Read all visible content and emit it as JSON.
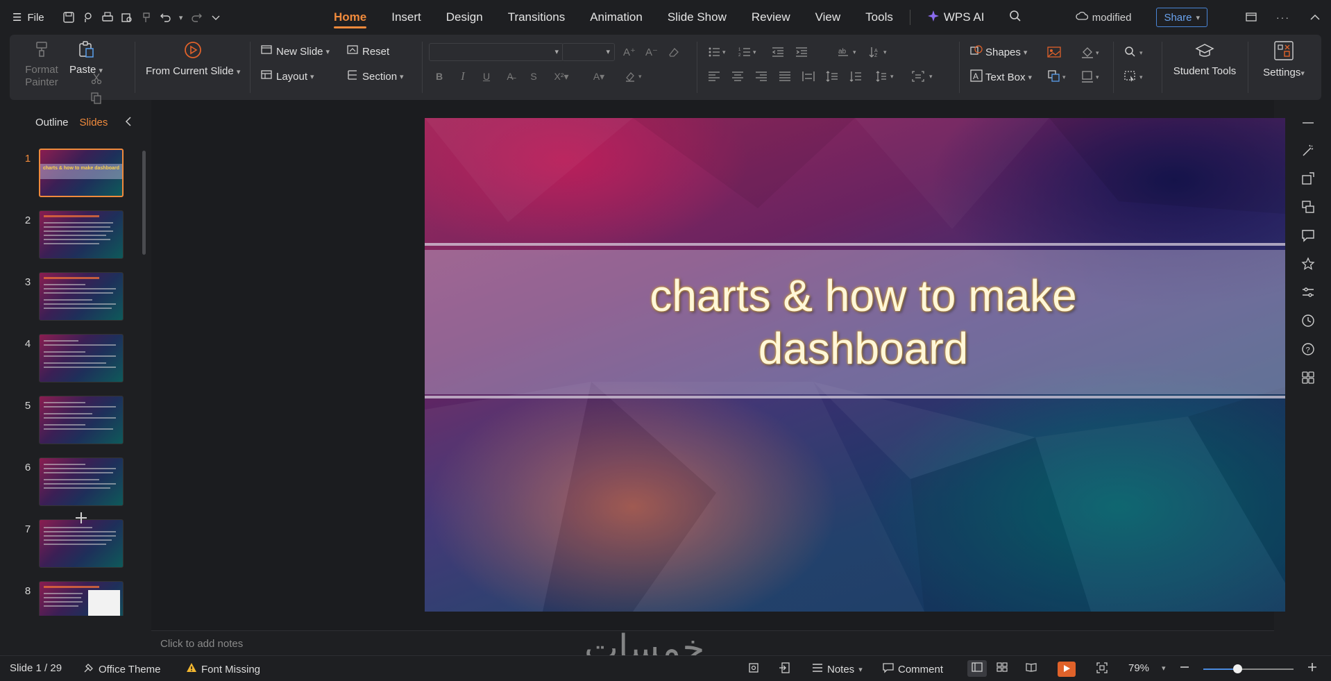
{
  "app": {
    "file_label": "File",
    "menu": [
      "Home",
      "Insert",
      "Design",
      "Transitions",
      "Animation",
      "Slide Show",
      "Review",
      "View",
      "Tools"
    ],
    "wps_ai_label": "WPS AI",
    "status_label": "modified",
    "share_label": "Share"
  },
  "ribbon": {
    "format_painter": "Format\nPainter",
    "paste": "Paste",
    "from_current_slide": "From Current Slide",
    "new_slide": "New  Slide",
    "reset": "Reset",
    "layout": "Layout",
    "section": "Section",
    "shapes": "Shapes",
    "text_box": "Text Box",
    "student_tools": "Student Tools",
    "settings": "Settings"
  },
  "panel": {
    "tab_outline": "Outline",
    "tab_slides": "Slides",
    "slides": [
      {
        "num": "1",
        "title": "charts & how to make dashboard"
      },
      {
        "num": "2"
      },
      {
        "num": "3"
      },
      {
        "num": "4"
      },
      {
        "num": "5"
      },
      {
        "num": "6"
      },
      {
        "num": "7"
      },
      {
        "num": "8"
      }
    ]
  },
  "slide": {
    "title_line1": "charts & how to make",
    "title_line2": "dashboard"
  },
  "notes_placeholder": "Click to add notes",
  "statusbar": {
    "slide_counter": "Slide 1 / 29",
    "theme": "Office Theme",
    "font_missing": "Font Missing",
    "notes": "Notes",
    "comment": "Comment",
    "zoom": "79%",
    "zoom_level": 0.38
  },
  "watermark": "خمسات",
  "colors": {
    "accent": "#f08a3c",
    "share": "#4a86d8",
    "play": "#e0622a"
  }
}
